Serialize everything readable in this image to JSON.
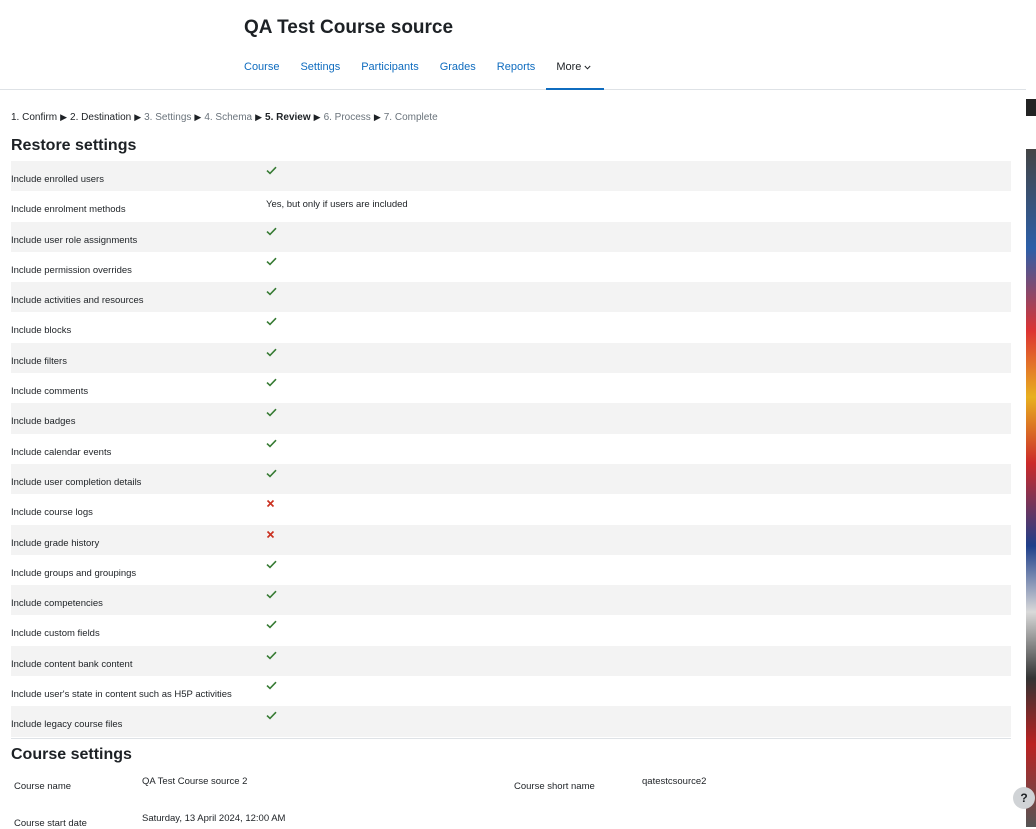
{
  "course": {
    "title": "QA Test Course source"
  },
  "nav": {
    "tabs": [
      "Course",
      "Settings",
      "Participants",
      "Grades",
      "Reports"
    ],
    "more_label": "More"
  },
  "breadcrumb": {
    "steps": [
      "1. Confirm",
      "2. Destination",
      "3. Settings",
      "4. Schema",
      "5. Review",
      "6. Process",
      "7. Complete"
    ],
    "current_step": "5. Review"
  },
  "restore": {
    "title": "Restore settings",
    "rows": [
      {
        "label": "Include enrolled users",
        "state": "check"
      },
      {
        "label": "Include enrolment methods",
        "state": "text",
        "text": "Yes, but only if users are included"
      },
      {
        "label": "Include user role assignments",
        "state": "check"
      },
      {
        "label": "Include permission overrides",
        "state": "check"
      },
      {
        "label": "Include activities and resources",
        "state": "check"
      },
      {
        "label": "Include blocks",
        "state": "check"
      },
      {
        "label": "Include filters",
        "state": "check"
      },
      {
        "label": "Include comments",
        "state": "check"
      },
      {
        "label": "Include badges",
        "state": "check"
      },
      {
        "label": "Include calendar events",
        "state": "check"
      },
      {
        "label": "Include user completion details",
        "state": "check"
      },
      {
        "label": "Include course logs",
        "state": "cross"
      },
      {
        "label": "Include grade history",
        "state": "cross"
      },
      {
        "label": "Include groups and groupings",
        "state": "check"
      },
      {
        "label": "Include competencies",
        "state": "check"
      },
      {
        "label": "Include custom fields",
        "state": "check"
      },
      {
        "label": "Include content bank content",
        "state": "check"
      },
      {
        "label": "Include user's state in content such as H5P activities",
        "state": "check"
      },
      {
        "label": "Include legacy course files",
        "state": "check"
      }
    ]
  },
  "course_settings": {
    "title": "Course settings",
    "course_name_label": "Course name",
    "course_name_value": "QA Test Course source 2",
    "short_name_label": "Course short name",
    "short_name_value": "qatestcsource2",
    "start_date_label": "Course start date",
    "start_date_value": "Saturday, 13 April 2024, 12:00 AM"
  },
  "help_label": "?",
  "colors": {
    "link": "#0f6cbf",
    "check": "#357a32",
    "cross": "#ca3120",
    "stripe": "#f3f3f3"
  },
  "icons": {
    "check": "check-icon",
    "cross": "cross-icon",
    "more": "chevron-down-icon"
  }
}
